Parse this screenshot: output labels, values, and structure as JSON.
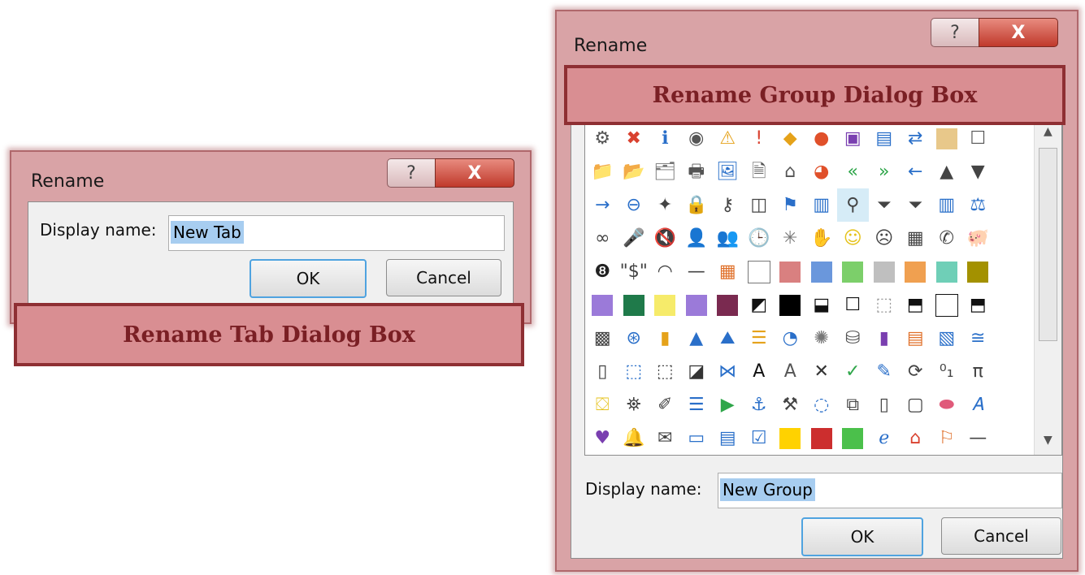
{
  "tab_dialog": {
    "title": "Rename",
    "help_label": "?",
    "close_label": "X",
    "display_label": "Display name:",
    "display_value": "New Tab",
    "ok_label": "OK",
    "cancel_label": "Cancel",
    "caption": "Rename Tab Dialog Box"
  },
  "group_dialog": {
    "title": "Rename",
    "help_label": "?",
    "close_label": "X",
    "display_label": "Display name:",
    "display_value": "New Group",
    "ok_label": "OK",
    "cancel_label": "Cancel",
    "caption": "Rename Group Dialog Box"
  },
  "icons": [
    {
      "t": "g",
      "g": "⚙",
      "c": "#555"
    },
    {
      "t": "g",
      "g": "✖",
      "c": "#d9412f"
    },
    {
      "t": "g",
      "g": "ℹ",
      "c": "#2a6fc9"
    },
    {
      "t": "g",
      "g": "◉",
      "c": "#555"
    },
    {
      "t": "g",
      "g": "⚠",
      "c": "#e5a21a"
    },
    {
      "t": "g",
      "g": "!",
      "c": "#d9412f"
    },
    {
      "t": "g",
      "g": "◆",
      "c": "#e5a21a"
    },
    {
      "t": "g",
      "g": "●",
      "c": "#e0502a"
    },
    {
      "t": "g",
      "g": "▣",
      "c": "#7a3fb0"
    },
    {
      "t": "g",
      "g": "▤",
      "c": "#2a6fc9"
    },
    {
      "t": "g",
      "g": "⇄",
      "c": "#2a6fc9"
    },
    {
      "t": "s",
      "c": "#e8c88a"
    },
    {
      "t": "g",
      "g": "☐",
      "c": "#555"
    },
    {
      "t": "g",
      "g": "",
      "c": "#555"
    },
    {
      "t": "g",
      "g": "📁",
      "c": "#d9a441"
    },
    {
      "t": "g",
      "g": "📂",
      "c": "#d9a441"
    },
    {
      "t": "g",
      "g": "🗂",
      "c": "#777"
    },
    {
      "t": "g",
      "g": "🖶",
      "c": "#555"
    },
    {
      "t": "g",
      "g": "🖼",
      "c": "#2a6fc9"
    },
    {
      "t": "g",
      "g": "🗎",
      "c": "#555"
    },
    {
      "t": "g",
      "g": "⌂",
      "c": "#555"
    },
    {
      "t": "g",
      "g": "◕",
      "c": "#e0502a"
    },
    {
      "t": "g",
      "g": "«",
      "c": "#2fa64a"
    },
    {
      "t": "g",
      "g": "»",
      "c": "#2fa64a"
    },
    {
      "t": "g",
      "g": "←",
      "c": "#2a6fc9"
    },
    {
      "t": "g",
      "g": "▲",
      "c": "#444"
    },
    {
      "t": "g",
      "g": "▼",
      "c": "#444"
    },
    {
      "t": "g",
      "g": "",
      "c": "#555"
    },
    {
      "t": "g",
      "g": "→",
      "c": "#2a6fc9"
    },
    {
      "t": "g",
      "g": "⊖",
      "c": "#2a6fc9"
    },
    {
      "t": "g",
      "g": "✦",
      "c": "#444"
    },
    {
      "t": "g",
      "g": "🔒",
      "c": "#e5a21a"
    },
    {
      "t": "g",
      "g": "⚷",
      "c": "#444"
    },
    {
      "t": "g",
      "g": "◫",
      "c": "#444"
    },
    {
      "t": "g",
      "g": "⚑",
      "c": "#2a6fc9"
    },
    {
      "t": "g",
      "g": "▥",
      "c": "#2a6fc9"
    },
    {
      "t": "g",
      "g": "⚲",
      "c": "#444",
      "sel": true
    },
    {
      "t": "g",
      "g": "⏷",
      "c": "#444"
    },
    {
      "t": "g",
      "g": "⏷",
      "c": "#444"
    },
    {
      "t": "g",
      "g": "▥",
      "c": "#2a6fc9"
    },
    {
      "t": "g",
      "g": "⚖",
      "c": "#2a6fc9"
    },
    {
      "t": "g",
      "g": "",
      "c": "#555"
    },
    {
      "t": "g",
      "g": "∞",
      "c": "#444"
    },
    {
      "t": "g",
      "g": "🎤",
      "c": "#2a6fc9"
    },
    {
      "t": "g",
      "g": "🔇",
      "c": "#d9412f"
    },
    {
      "t": "g",
      "g": "👤",
      "c": "#444"
    },
    {
      "t": "g",
      "g": "👥",
      "c": "#444"
    },
    {
      "t": "g",
      "g": "🕒",
      "c": "#2a6fc9"
    },
    {
      "t": "g",
      "g": "✳",
      "c": "#777"
    },
    {
      "t": "g",
      "g": "✋",
      "c": "#444"
    },
    {
      "t": "g",
      "g": "☺",
      "c": "#e5c21a"
    },
    {
      "t": "g",
      "g": "☹",
      "c": "#444"
    },
    {
      "t": "g",
      "g": "▦",
      "c": "#444"
    },
    {
      "t": "g",
      "g": "✆",
      "c": "#444"
    },
    {
      "t": "g",
      "g": "🐖",
      "c": "#444"
    },
    {
      "t": "g",
      "g": "",
      "c": "#555"
    },
    {
      "t": "g",
      "g": "❽",
      "c": "#222"
    },
    {
      "t": "g",
      "g": "\"$\"",
      "c": "#444"
    },
    {
      "t": "g",
      "g": "◠",
      "c": "#444"
    },
    {
      "t": "g",
      "g": "—",
      "c": "#444"
    },
    {
      "t": "g",
      "g": "▦",
      "c": "#e0702a"
    },
    {
      "t": "s",
      "c": "#ffffff",
      "b": "#777"
    },
    {
      "t": "s",
      "c": "#d98080"
    },
    {
      "t": "s",
      "c": "#6a97dc"
    },
    {
      "t": "s",
      "c": "#7ccf6a"
    },
    {
      "t": "s",
      "c": "#bfbfbf"
    },
    {
      "t": "s",
      "c": "#f0a050"
    },
    {
      "t": "s",
      "c": "#6fcfb7"
    },
    {
      "t": "s",
      "c": "#a39100"
    },
    {
      "t": "g",
      "g": "",
      "c": "#555"
    },
    {
      "t": "s",
      "c": "#9b7ad9"
    },
    {
      "t": "s",
      "c": "#1f7a4a"
    },
    {
      "t": "s",
      "c": "#f6eb6a"
    },
    {
      "t": "s",
      "c": "#9b7ad9"
    },
    {
      "t": "s",
      "c": "#7a2a50"
    },
    {
      "t": "g",
      "g": "◩",
      "c": "#111"
    },
    {
      "t": "s",
      "c": "#000000"
    },
    {
      "t": "g",
      "g": "⬓",
      "c": "#111"
    },
    {
      "t": "g",
      "g": "☐",
      "c": "#111"
    },
    {
      "t": "g",
      "g": "⬚",
      "c": "#999"
    },
    {
      "t": "g",
      "g": "⬒",
      "c": "#111"
    },
    {
      "t": "s",
      "c": "#ffffff",
      "b": "#111"
    },
    {
      "t": "g",
      "g": "⬒",
      "c": "#111"
    },
    {
      "t": "g",
      "g": "",
      "c": "#555"
    },
    {
      "t": "g",
      "g": "▩",
      "c": "#444"
    },
    {
      "t": "g",
      "g": "⊛",
      "c": "#2a6fc9"
    },
    {
      "t": "g",
      "g": "▮",
      "c": "#e5a21a"
    },
    {
      "t": "g",
      "g": "▲",
      "c": "#2a6fc9"
    },
    {
      "t": "g",
      "g": "⛰",
      "c": "#2a6fc9"
    },
    {
      "t": "g",
      "g": "☰",
      "c": "#e5a21a"
    },
    {
      "t": "g",
      "g": "◔",
      "c": "#2a6fc9"
    },
    {
      "t": "g",
      "g": "✺",
      "c": "#777"
    },
    {
      "t": "g",
      "g": "⛁",
      "c": "#555"
    },
    {
      "t": "g",
      "g": "▮",
      "c": "#7a3fb0"
    },
    {
      "t": "g",
      "g": "▤",
      "c": "#e0702a"
    },
    {
      "t": "g",
      "g": "▧",
      "c": "#2a6fc9"
    },
    {
      "t": "g",
      "g": "≅",
      "c": "#2a6fc9"
    },
    {
      "t": "g",
      "g": "",
      "c": "#555"
    },
    {
      "t": "g",
      "g": "▯",
      "c": "#444"
    },
    {
      "t": "g",
      "g": "⬚",
      "c": "#2a6fc9"
    },
    {
      "t": "g",
      "g": "⬚",
      "c": "#444"
    },
    {
      "t": "g",
      "g": "◪",
      "c": "#333"
    },
    {
      "t": "g",
      "g": "⋈",
      "c": "#2a6fc9"
    },
    {
      "t": "g",
      "g": "A",
      "c": "#111"
    },
    {
      "t": "g",
      "g": "A",
      "c": "#555"
    },
    {
      "t": "g",
      "g": "✕",
      "c": "#333"
    },
    {
      "t": "g",
      "g": "✓",
      "c": "#2fa64a"
    },
    {
      "t": "g",
      "g": "✎",
      "c": "#2a6fc9"
    },
    {
      "t": "g",
      "g": "⟳",
      "c": "#444"
    },
    {
      "t": "g",
      "g": "⁰₁",
      "c": "#444"
    },
    {
      "t": "g",
      "g": "π",
      "c": "#444"
    },
    {
      "t": "g",
      "g": "",
      "c": "#555"
    },
    {
      "t": "g",
      "g": "⛋",
      "c": "#e5c21a"
    },
    {
      "t": "g",
      "g": "⛯",
      "c": "#444"
    },
    {
      "t": "g",
      "g": "✐",
      "c": "#444"
    },
    {
      "t": "g",
      "g": "☰",
      "c": "#2a6fc9"
    },
    {
      "t": "g",
      "g": "▶",
      "c": "#2fa64a"
    },
    {
      "t": "g",
      "g": "⚓",
      "c": "#2a6fc9"
    },
    {
      "t": "g",
      "g": "⚒",
      "c": "#444"
    },
    {
      "t": "g",
      "g": "◌",
      "c": "#2a6fc9"
    },
    {
      "t": "g",
      "g": "⧉",
      "c": "#444"
    },
    {
      "t": "g",
      "g": "▯",
      "c": "#444"
    },
    {
      "t": "g",
      "g": "▢",
      "c": "#444"
    },
    {
      "t": "g",
      "g": "⬬",
      "c": "#e05a7a"
    },
    {
      "t": "g",
      "g": "𝐴",
      "c": "#2a6fc9"
    },
    {
      "t": "g",
      "g": "",
      "c": "#555"
    },
    {
      "t": "g",
      "g": "♥",
      "c": "#7a3fb0"
    },
    {
      "t": "g",
      "g": "🔔",
      "c": "#e5a21a"
    },
    {
      "t": "g",
      "g": "✉",
      "c": "#444"
    },
    {
      "t": "g",
      "g": "▭",
      "c": "#2a6fc9"
    },
    {
      "t": "g",
      "g": "▤",
      "c": "#2a6fc9"
    },
    {
      "t": "g",
      "g": "☑",
      "c": "#2a6fc9"
    },
    {
      "t": "s",
      "c": "#ffd200"
    },
    {
      "t": "s",
      "c": "#cc2e2e"
    },
    {
      "t": "s",
      "c": "#4bc04b"
    },
    {
      "t": "g",
      "g": "ℯ",
      "c": "#2a6fc9"
    },
    {
      "t": "g",
      "g": "⌂",
      "c": "#d9412f"
    },
    {
      "t": "g",
      "g": "⚐",
      "c": "#e0702a"
    },
    {
      "t": "g",
      "g": "—",
      "c": "#444"
    },
    {
      "t": "g",
      "g": "",
      "c": "#555"
    }
  ]
}
